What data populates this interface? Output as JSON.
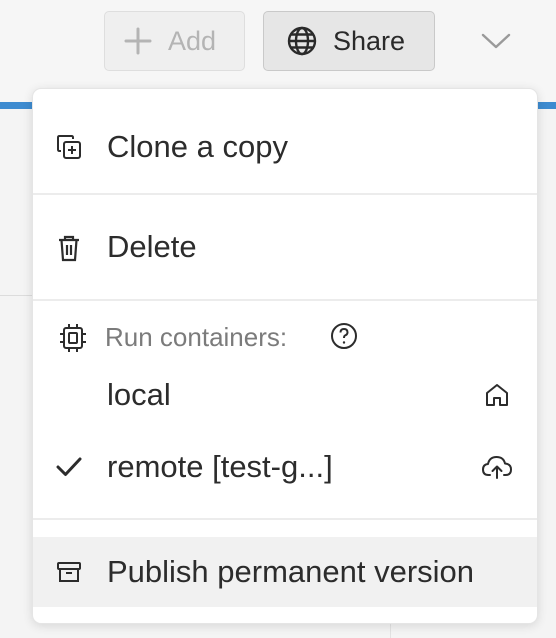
{
  "toolbar": {
    "add_label": "Add",
    "share_label": "Share",
    "add_icon": "plus-icon",
    "share_icon": "globe-icon",
    "more_icon": "chevron-down-icon"
  },
  "menu": {
    "clone_label": "Clone a copy",
    "delete_label": "Delete",
    "run_containers_label": "Run containers:",
    "local_label": "local",
    "remote_label": "remote [test-g...]",
    "remote_selected": true,
    "publish_label": "Publish permanent version",
    "icons": {
      "clone": "clone-icon",
      "delete": "trash-icon",
      "containers": "chip-icon",
      "help": "help-circle-icon",
      "local": "home-icon",
      "remote": "cloud-upload-icon",
      "selected": "check-icon",
      "publish": "archive-icon"
    }
  },
  "colors": {
    "accent": "#3d8bd0",
    "menu_background": "#ffffff",
    "highlight": "#f1f1f1",
    "muted_text": "#7b7b7b"
  }
}
